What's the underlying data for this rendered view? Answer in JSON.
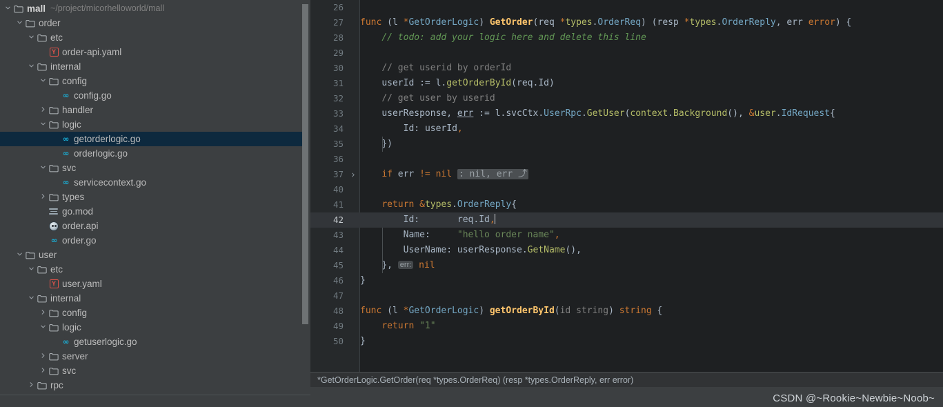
{
  "project": {
    "root_label": "mall",
    "root_path": "~/project/micorhelloworld/mall",
    "tree": [
      {
        "label": "order",
        "indent": 1,
        "arrow": "down",
        "icon": "folder-icon"
      },
      {
        "label": "etc",
        "indent": 2,
        "arrow": "down",
        "icon": "folder-icon"
      },
      {
        "label": "order-api.yaml",
        "indent": 3,
        "arrow": "none",
        "icon": "yaml-file-icon"
      },
      {
        "label": "internal",
        "indent": 2,
        "arrow": "down",
        "icon": "folder-icon"
      },
      {
        "label": "config",
        "indent": 3,
        "arrow": "down",
        "icon": "folder-icon"
      },
      {
        "label": "config.go",
        "indent": 4,
        "arrow": "none",
        "icon": "go-file-icon"
      },
      {
        "label": "handler",
        "indent": 3,
        "arrow": "right",
        "icon": "folder-icon"
      },
      {
        "label": "logic",
        "indent": 3,
        "arrow": "down",
        "icon": "folder-icon"
      },
      {
        "label": "getorderlogic.go",
        "indent": 4,
        "arrow": "none",
        "icon": "go-file-icon",
        "selected": true
      },
      {
        "label": "orderlogic.go",
        "indent": 4,
        "arrow": "none",
        "icon": "go-file-icon"
      },
      {
        "label": "svc",
        "indent": 3,
        "arrow": "down",
        "icon": "folder-icon"
      },
      {
        "label": "servicecontext.go",
        "indent": 4,
        "arrow": "none",
        "icon": "go-file-icon"
      },
      {
        "label": "types",
        "indent": 3,
        "arrow": "right",
        "icon": "folder-icon"
      },
      {
        "label": "go.mod",
        "indent": 3,
        "arrow": "none",
        "icon": "modules-file-icon"
      },
      {
        "label": "order.api",
        "indent": 3,
        "arrow": "none",
        "icon": "api-file-icon"
      },
      {
        "label": "order.go",
        "indent": 3,
        "arrow": "none",
        "icon": "go-file-icon"
      },
      {
        "label": "user",
        "indent": 1,
        "arrow": "down",
        "icon": "folder-icon"
      },
      {
        "label": "etc",
        "indent": 2,
        "arrow": "down",
        "icon": "folder-icon"
      },
      {
        "label": "user.yaml",
        "indent": 3,
        "arrow": "none",
        "icon": "yaml-file-icon"
      },
      {
        "label": "internal",
        "indent": 2,
        "arrow": "down",
        "icon": "folder-icon"
      },
      {
        "label": "config",
        "indent": 3,
        "arrow": "right",
        "icon": "folder-icon"
      },
      {
        "label": "logic",
        "indent": 3,
        "arrow": "down",
        "icon": "folder-icon"
      },
      {
        "label": "getuserlogic.go",
        "indent": 4,
        "arrow": "none",
        "icon": "go-file-icon"
      },
      {
        "label": "server",
        "indent": 3,
        "arrow": "right",
        "icon": "folder-icon"
      },
      {
        "label": "svc",
        "indent": 3,
        "arrow": "right",
        "icon": "folder-icon"
      },
      {
        "label": "rpc",
        "indent": 2,
        "arrow": "right",
        "icon": "folder-icon"
      }
    ]
  },
  "editor": {
    "first_line": 26,
    "current_line": 42,
    "lines": [
      {
        "num": "26",
        "html": ""
      },
      {
        "num": "27",
        "html": "<span class='k'>func</span> <span class='p'>(</span><span class='var'>l</span> <span class='k'>*</span><span class='cls'>GetOrderLogic</span><span class='p'>)</span> <span class='fn'>GetOrder</span><span class='p'>(</span><span class='var'>req</span> <span class='k'>*</span><span class='pkg'>types</span><span class='p'>.</span><span class='cls'>OrderReq</span><span class='p'>)</span> <span class='p'>(</span><span class='var'>resp</span> <span class='k'>*</span><span class='pkg'>types</span><span class='p'>.</span><span class='cls'>OrderReply</span><span class='p'>,</span> <span class='var'>err</span> <span class='k'>error</span><span class='p'>)</span> <span class='p'>{</span>"
      },
      {
        "num": "28",
        "html": "    <span class='cmt'>// todo: add your logic here and delete this line</span>"
      },
      {
        "num": "29",
        "html": ""
      },
      {
        "num": "30",
        "html": "    <span class='cm'>// get userid by orderId</span>"
      },
      {
        "num": "31",
        "html": "    <span class='var'>userId</span> <span class='p'>:=</span> <span class='var'>l</span><span class='p'>.</span><span class='pkg'>getOrderById</span><span class='p'>(</span><span class='var'>req</span><span class='p'>.</span><span class='var'>Id</span><span class='p'>)</span>"
      },
      {
        "num": "32",
        "html": "    <span class='cm'>// get user by userid</span>"
      },
      {
        "num": "33",
        "html": "    <span class='var'>userResponse</span><span class='p'>,</span> <span class='var err-underline'>err</span> <span class='p'>:=</span> <span class='var'>l</span><span class='p'>.</span><span class='var'>svcCtx</span><span class='p'>.</span><span class='cls'>UserRpc</span><span class='p'>.</span><span class='pkg'>GetUser</span><span class='p'>(</span><span class='pkg'>context</span><span class='p'>.</span><span class='pkg'>Background</span><span class='p'>(),</span> <span class='k'>&amp;</span><span class='pkg'>user</span><span class='p'>.</span><span class='cls'>IdRequest</span><span class='p'>{</span>"
      },
      {
        "num": "34",
        "html": "        <span class='var'>Id</span><span class='p'>:</span> <span class='var'>userId</span><span class='k'>,</span>"
      },
      {
        "num": "35",
        "html": "    <span class='p'>})</span>"
      },
      {
        "num": "36",
        "html": ""
      },
      {
        "num": "37",
        "html": "    <span class='k'>if</span> <span class='var'>err</span> <span class='k'>!=</span> <span class='k'>nil</span> <span class='fold'>: nil, err ⤴</span>",
        "fold": true
      },
      {
        "num": "40",
        "html": ""
      },
      {
        "num": "41",
        "html": "    <span class='k'>return</span> <span class='k'>&amp;</span><span class='pkg'>types</span><span class='p'>.</span><span class='cls'>OrderReply</span><span class='p'>{</span>"
      },
      {
        "num": "42",
        "html": "        <span class='var'>Id</span><span class='p'>:</span>       <span class='var'>req</span><span class='p'>.</span><span class='var'>Id</span><span class='k'>,</span><span class='caret'></span>",
        "current": true
      },
      {
        "num": "43",
        "html": "        <span class='var'>Name</span><span class='p'>:</span>     <span class='str'>\"hello order name\"</span><span class='k'>,</span>"
      },
      {
        "num": "44",
        "html": "        <span class='var'>UserName</span><span class='p'>:</span> <span class='var'>userResponse</span><span class='p'>.</span><span class='pkg'>GetName</span><span class='p'>(),</span>"
      },
      {
        "num": "45",
        "html": "    <span class='p'>},</span> <span class='hint'>err:</span> <span class='k'>nil</span>"
      },
      {
        "num": "46",
        "html": "<span class='p'>}</span>"
      },
      {
        "num": "47",
        "html": ""
      },
      {
        "num": "48",
        "html": "<span class='k'>func</span> <span class='p'>(</span><span class='var'>l</span> <span class='k'>*</span><span class='cls'>GetOrderLogic</span><span class='p'>)</span> <span class='fn'>getOrderById</span><span class='p'>(</span><span class='cm'>id string</span><span class='p'>)</span> <span class='k'>string</span> <span class='p'>{</span>"
      },
      {
        "num": "49",
        "html": "    <span class='k'>return</span> <span class='str'>\"1\"</span>"
      },
      {
        "num": "50",
        "html": "<span class='p'>}</span>"
      }
    ]
  },
  "statusbar": {
    "breadcrumb": "*GetOrderLogic.GetOrder(req *types.OrderReq) (resp *types.OrderReply, err error)"
  },
  "watermark": {
    "text": "CSDN @~Rookie~Newbie~Noob~"
  },
  "colors": {
    "selection": "#0d293e",
    "editor_bg": "#1e2022",
    "sidebar_bg": "#3c3f41",
    "gutter_bg": "#26292b",
    "keyword": "#cc7832",
    "string": "#6a8759",
    "comment": "#808080",
    "todo_comment": "#629755",
    "func_name": "#ffc66d",
    "type_name": "#74a7c4",
    "package": "#b5bd68",
    "go_icon": "#1ab0d8",
    "yaml_icon": "#e0534a"
  }
}
